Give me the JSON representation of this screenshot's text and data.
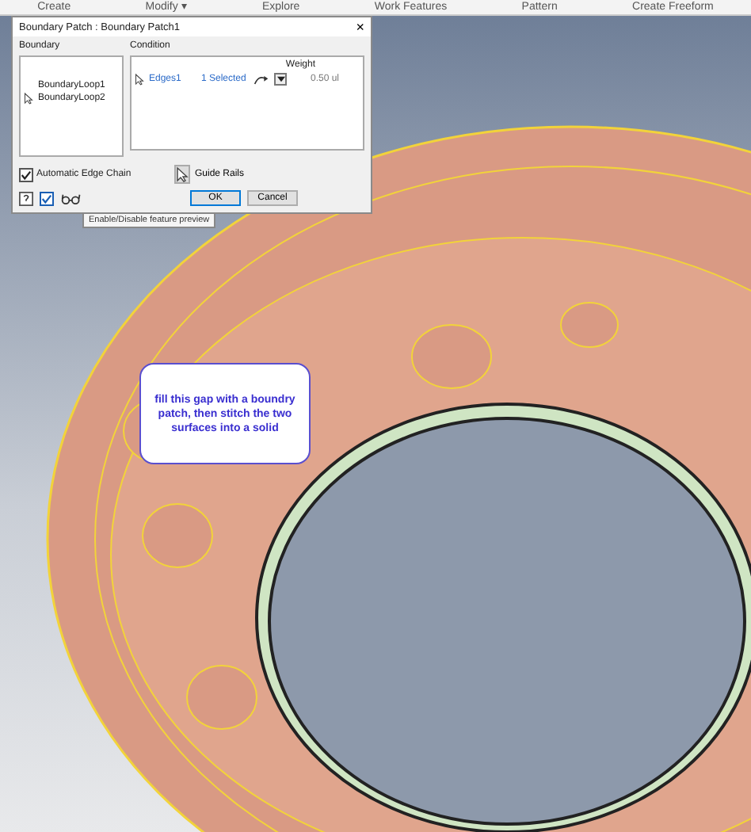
{
  "ribbon": {
    "groups": [
      "Create",
      "Modify ▾",
      "Explore",
      "Work Features",
      "Pattern",
      "Create Freeform"
    ]
  },
  "dialog": {
    "title": "Boundary Patch : Boundary Patch1",
    "close": "×",
    "boundary": {
      "label": "Boundary",
      "loops": [
        {
          "name": "BoundaryLoop1",
          "selected": false
        },
        {
          "name": "BoundaryLoop2",
          "selected": true
        }
      ]
    },
    "condition": {
      "label": "Condition",
      "weight_header": "Weight",
      "rows": [
        {
          "edges": "Edges1",
          "selection": "1 Selected",
          "weight": "0.50 ul"
        }
      ]
    },
    "automatic_edge_chain": {
      "label": "Automatic Edge Chain",
      "checked": true
    },
    "guide_rails": "Guide Rails",
    "preview": {
      "checked": true
    },
    "buttons": [
      "OK",
      "Cancel"
    ]
  },
  "tooltip": "Enable/Disable feature preview",
  "callout": "fill this gap with a boundry patch, then stitch the two surfaces into a solid"
}
